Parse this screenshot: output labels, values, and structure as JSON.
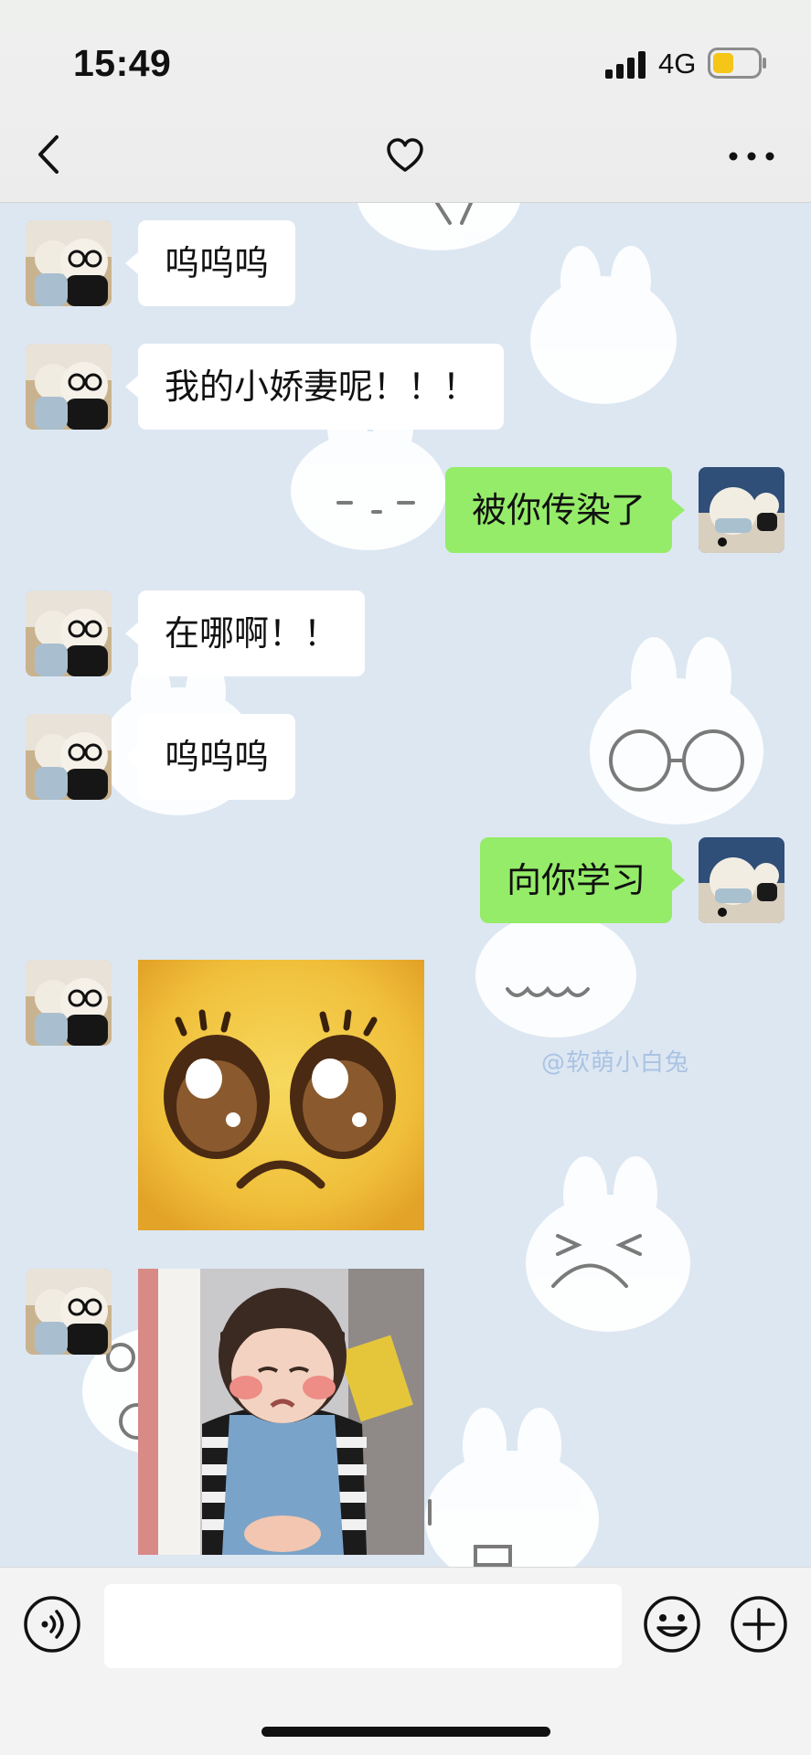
{
  "status_bar": {
    "time": "15:49",
    "network": "4G",
    "battery_color": "#f5c518"
  },
  "header": {
    "back_icon": "chevron-left-icon",
    "favorite_icon": "heart-icon",
    "more_icon": "more-dots-icon"
  },
  "messages": [
    {
      "side": "in",
      "type": "text",
      "text": "呜呜呜"
    },
    {
      "side": "in",
      "type": "text",
      "text": "我的小娇妻呢！！！"
    },
    {
      "side": "out",
      "type": "text",
      "text": "被你传染了"
    },
    {
      "side": "in",
      "type": "text",
      "text": "在哪啊！！"
    },
    {
      "side": "in",
      "type": "text",
      "text": "呜呜呜"
    },
    {
      "side": "out",
      "type": "text",
      "text": "向你学习"
    },
    {
      "side": "in",
      "type": "sticker",
      "sticker": "pleading-face-emoji"
    },
    {
      "side": "in",
      "type": "sticker",
      "sticker": "crying-child-photo"
    }
  ],
  "background": {
    "watermark": "@软萌小白兔"
  },
  "colors": {
    "outgoing_bubble": "#95ec69",
    "incoming_bubble": "#ffffff",
    "chat_background": "#dde7f2"
  },
  "input_bar": {
    "voice_icon": "voice-icon",
    "emoji_icon": "emoji-icon",
    "plus_icon": "plus-icon",
    "message_placeholder": ""
  }
}
